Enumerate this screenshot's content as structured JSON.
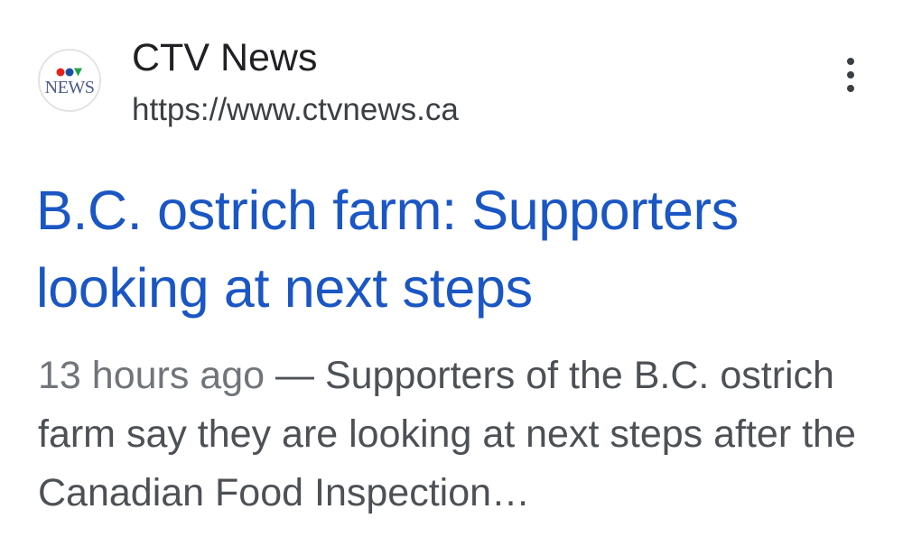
{
  "result": {
    "source": {
      "name": "CTV News",
      "url": "https://www.ctvnews.ca",
      "favicon_icon": "ctv-news-logo",
      "favicon_text": "NEWS"
    },
    "more_options_icon": "more-vert-icon",
    "headline": "B.C. ostrich farm: Supporters looking at next steps",
    "snippet": {
      "date": "13 hours ago",
      "separator": " — ",
      "text": "Supporters of the B.C. ostrich farm say they are looking at next steps after the Canadian Food Inspection…"
    },
    "colors": {
      "headline": "#1a56c4",
      "source_name": "#202124",
      "snippet": "#4d5156"
    }
  }
}
